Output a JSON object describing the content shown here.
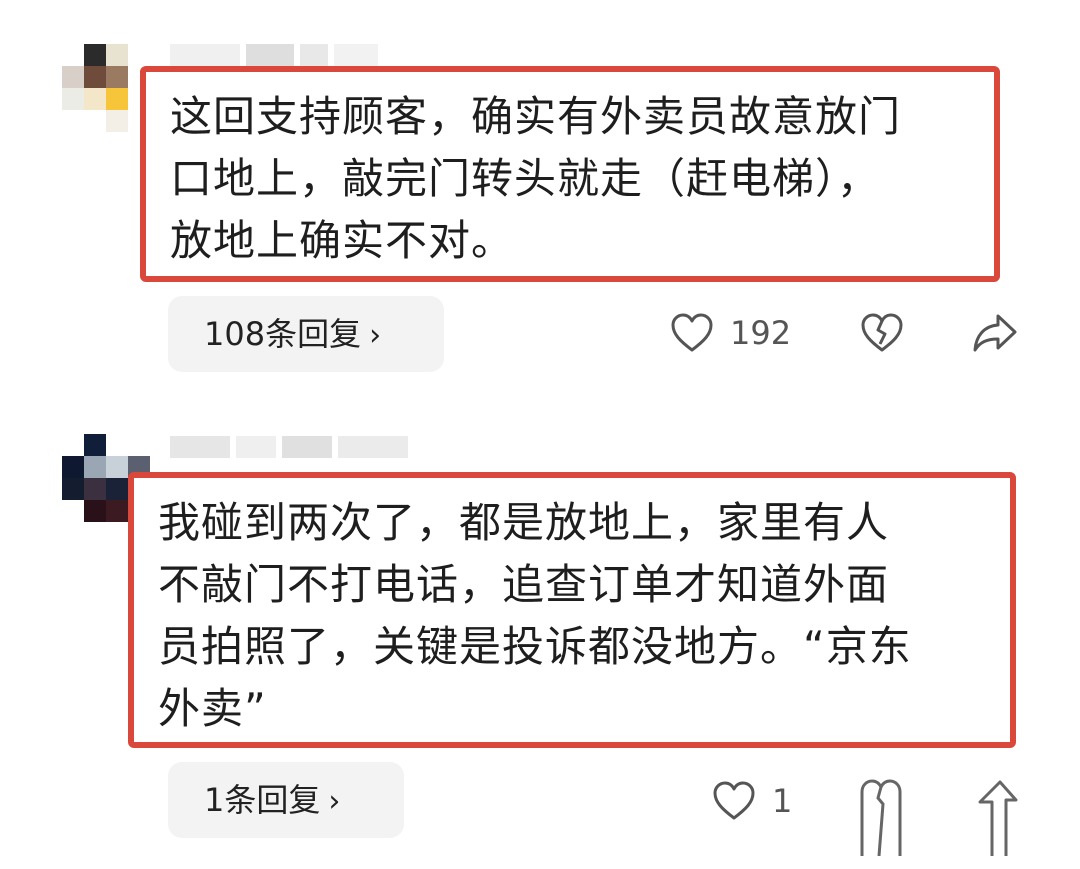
{
  "comments": [
    {
      "lines": [
        "这回支持顾客，确实有外卖员故意放门",
        "口地上，敲完门转头就走（赶电梯），",
        "放地上确实不对。"
      ],
      "reply_label": "108条回复",
      "like_count": "192",
      "avatar_icon": "user-avatar",
      "highlight_color": "#d9483b"
    },
    {
      "lines": [
        "我碰到两次了，都是放地上，家里有人",
        "不敲门不打电话，追查订单才知道外面",
        "员拍照了，关键是投诉都没地方。“京东",
        "外卖”"
      ],
      "reply_label": "1条回复",
      "like_count": "1",
      "avatar_icon": "user-avatar",
      "highlight_color": "#d9483b"
    }
  ],
  "icons": {
    "like": "heart-icon",
    "dislike": "broken-heart-icon",
    "share": "share-arrow-icon",
    "reply_chevron": "›"
  }
}
